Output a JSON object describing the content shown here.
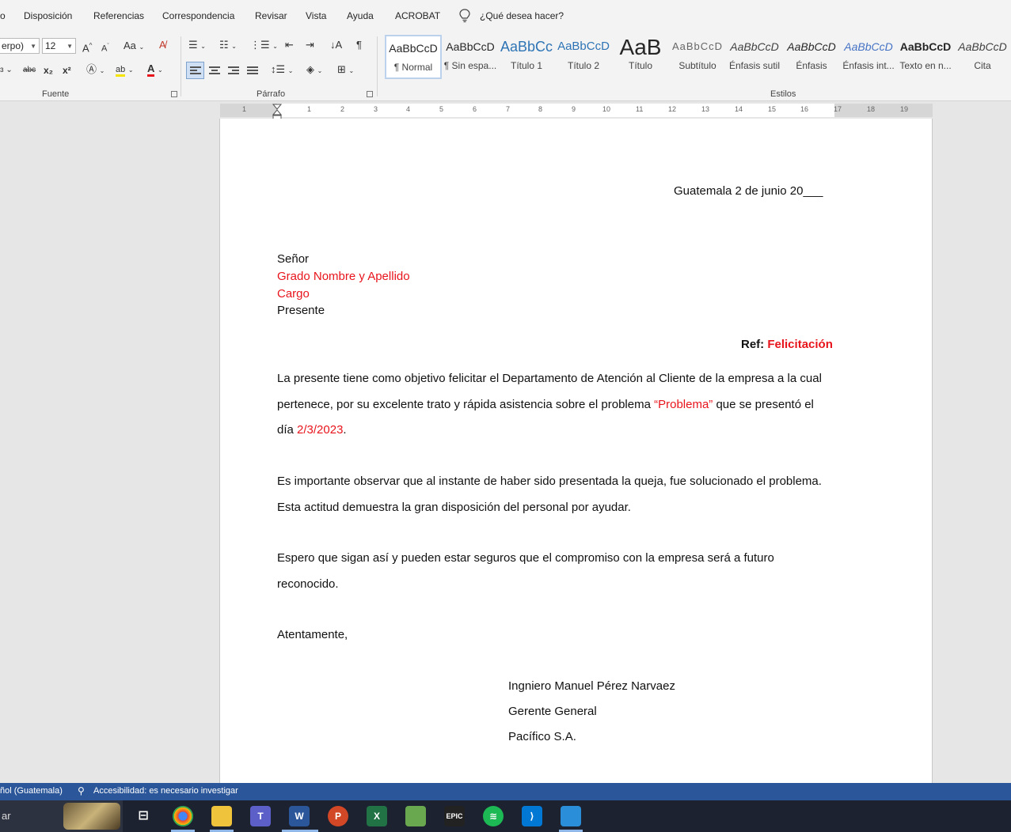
{
  "menu": {
    "items": [
      "o",
      "Disposición",
      "Referencias",
      "Correspondencia",
      "Revisar",
      "Vista",
      "Ayuda",
      "ACROBAT"
    ],
    "tell_me": "¿Qué desea hacer?"
  },
  "ribbon": {
    "font_name": "erpo)",
    "font_size": "12",
    "change_case": "Aa",
    "strikethrough": "abc",
    "subscript": "x₂",
    "superscript": "x²",
    "font_group_label": "Fuente",
    "paragraph_group_label": "Párrafo",
    "styles_group_label": "Estilos",
    "styles": [
      {
        "preview": "AaBbCcD",
        "name": "¶ Normal"
      },
      {
        "preview": "AaBbCcD",
        "name": "¶ Sin espa..."
      },
      {
        "preview": "AaBbCc",
        "name": "Título 1"
      },
      {
        "preview": "AaBbCcD",
        "name": "Título 2"
      },
      {
        "preview": "AaB",
        "name": "Título"
      },
      {
        "preview": "AaBbCcD",
        "name": "Subtítulo"
      },
      {
        "preview": "AaBbCcD",
        "name": "Énfasis sutil"
      },
      {
        "preview": "AaBbCcD",
        "name": "Énfasis"
      },
      {
        "preview": "AaBbCcD",
        "name": "Énfasis int..."
      },
      {
        "preview": "AaBbCcD",
        "name": "Texto en n..."
      },
      {
        "preview": "AaBbCcD",
        "name": "Cita"
      }
    ]
  },
  "ruler": {
    "numbers": [
      "1",
      "1",
      "2",
      "3",
      "4",
      "5",
      "6",
      "7",
      "8",
      "9",
      "10",
      "11",
      "12",
      "13",
      "14",
      "15",
      "16",
      "17",
      "18",
      "19"
    ]
  },
  "document": {
    "date_line": "Guatemala 2 de junio 20___",
    "salutation": "Señor",
    "recipient_name": "Grado Nombre y Apellido",
    "recipient_title": "Cargo",
    "presente": "Presente",
    "ref_label": "Ref: ",
    "ref_value": "Felicitación",
    "p1_a": "   La presente tiene como objetivo felicitar el Departamento de Atención al Cliente de la empresa a la cual pertenece, por su excelente trato y rápida asistencia sobre el problema ",
    "p1_problem": "“Problema”",
    "p1_b": " que se presentó el día ",
    "p1_date": "2/3/2023",
    "p1_c": ".",
    "p2": "   Es importante observar que al instante de haber sido presentada la queja, fue solucionado el problema. Esta actitud demuestra la gran disposición del personal por ayudar.",
    "p3": "   Espero que sigan así y pueden estar seguros que el compromiso con la empresa será a futuro reconocido.",
    "closing": "   Atentamente,",
    "signer_name": "Ingniero Manuel Pérez Narvaez",
    "signer_title": "Gerente General",
    "signer_company": "Pacífico S.A."
  },
  "statusbar": {
    "language": "ñol (Guatemala)",
    "accessibility": "Accesibilidad: es necesario investigar"
  },
  "taskbar": {
    "search_text": "ar",
    "apps": [
      "chrome",
      "file-explorer",
      "teams",
      "word",
      "powerpoint",
      "excel",
      "minecraft",
      "epic-games",
      "spotify",
      "vscode",
      "photos"
    ]
  },
  "colors": {
    "accent_red": "#e8141c",
    "status_blue": "#2b579a",
    "taskbar": "#1c2230"
  }
}
